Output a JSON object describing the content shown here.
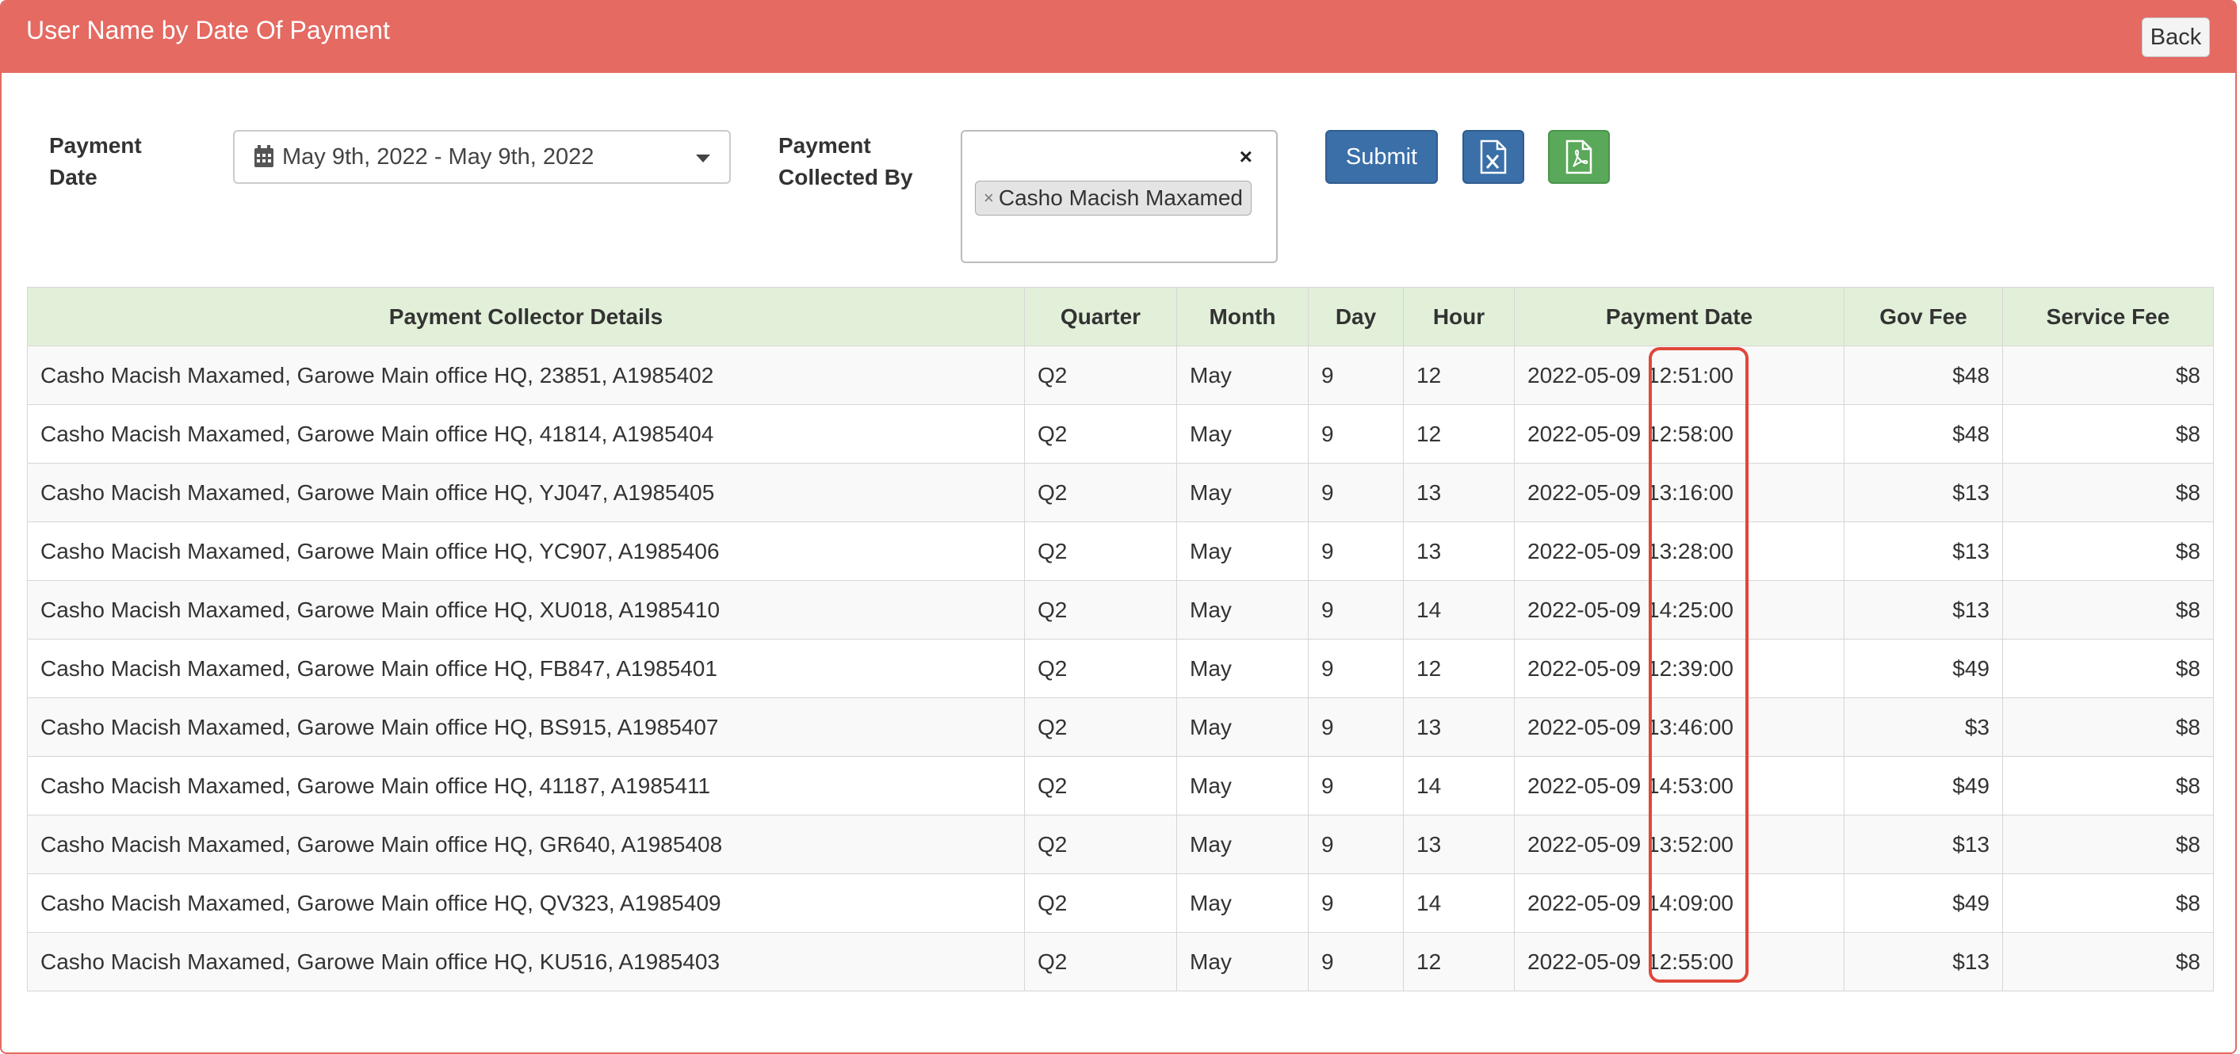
{
  "header": {
    "title": "User Name by Date Of Payment",
    "back_label": "Back"
  },
  "filters": {
    "payment_date_label": "Payment Date",
    "date_range": "May 9th, 2022 - May 9th, 2022",
    "collected_by_label": "Payment Collected By",
    "clear_all": "×",
    "selected_collector": "Casho Macish Maxamed",
    "tag_remove": "×",
    "submit_label": "Submit"
  },
  "colors": {
    "header": "#e46a62",
    "submit": "#3a6fa8",
    "excel": "#3a6fa8",
    "pdf": "#5aa85a",
    "table_header": "#e2f0d9",
    "highlight": "#e0473a"
  },
  "icons": {
    "calendar": "calendar-icon",
    "excel": "excel-file-icon",
    "pdf": "pdf-file-icon"
  },
  "table": {
    "columns": [
      "Payment Collector Details",
      "Quarter",
      "Month",
      "Day",
      "Hour",
      "Payment Date",
      "Gov Fee",
      "Service Fee"
    ],
    "rows": [
      [
        "Casho Macish Maxamed, Garowe Main office HQ, 23851, A1985402",
        "Q2",
        "May",
        "9",
        "12",
        "2022-05-09 12:51:00",
        "$48",
        "$8"
      ],
      [
        "Casho Macish Maxamed, Garowe Main office HQ, 41814, A1985404",
        "Q2",
        "May",
        "9",
        "12",
        "2022-05-09 12:58:00",
        "$48",
        "$8"
      ],
      [
        "Casho Macish Maxamed, Garowe Main office HQ, YJ047, A1985405",
        "Q2",
        "May",
        "9",
        "13",
        "2022-05-09 13:16:00",
        "$13",
        "$8"
      ],
      [
        "Casho Macish Maxamed, Garowe Main office HQ, YC907, A1985406",
        "Q2",
        "May",
        "9",
        "13",
        "2022-05-09 13:28:00",
        "$13",
        "$8"
      ],
      [
        "Casho Macish Maxamed, Garowe Main office HQ, XU018, A1985410",
        "Q2",
        "May",
        "9",
        "14",
        "2022-05-09 14:25:00",
        "$13",
        "$8"
      ],
      [
        "Casho Macish Maxamed, Garowe Main office HQ, FB847, A1985401",
        "Q2",
        "May",
        "9",
        "12",
        "2022-05-09 12:39:00",
        "$49",
        "$8"
      ],
      [
        "Casho Macish Maxamed, Garowe Main office HQ, BS915, A1985407",
        "Q2",
        "May",
        "9",
        "13",
        "2022-05-09 13:46:00",
        "$3",
        "$8"
      ],
      [
        "Casho Macish Maxamed, Garowe Main office HQ, 41187, A1985411",
        "Q2",
        "May",
        "9",
        "14",
        "2022-05-09 14:53:00",
        "$49",
        "$8"
      ],
      [
        "Casho Macish Maxamed, Garowe Main office HQ, GR640, A1985408",
        "Q2",
        "May",
        "9",
        "13",
        "2022-05-09 13:52:00",
        "$13",
        "$8"
      ],
      [
        "Casho Macish Maxamed, Garowe Main office HQ, QV323, A1985409",
        "Q2",
        "May",
        "9",
        "14",
        "2022-05-09 14:09:00",
        "$49",
        "$8"
      ],
      [
        "Casho Macish Maxamed, Garowe Main office HQ, KU516, A1985403",
        "Q2",
        "May",
        "9",
        "12",
        "2022-05-09 12:55:00",
        "$13",
        "$8"
      ]
    ]
  }
}
